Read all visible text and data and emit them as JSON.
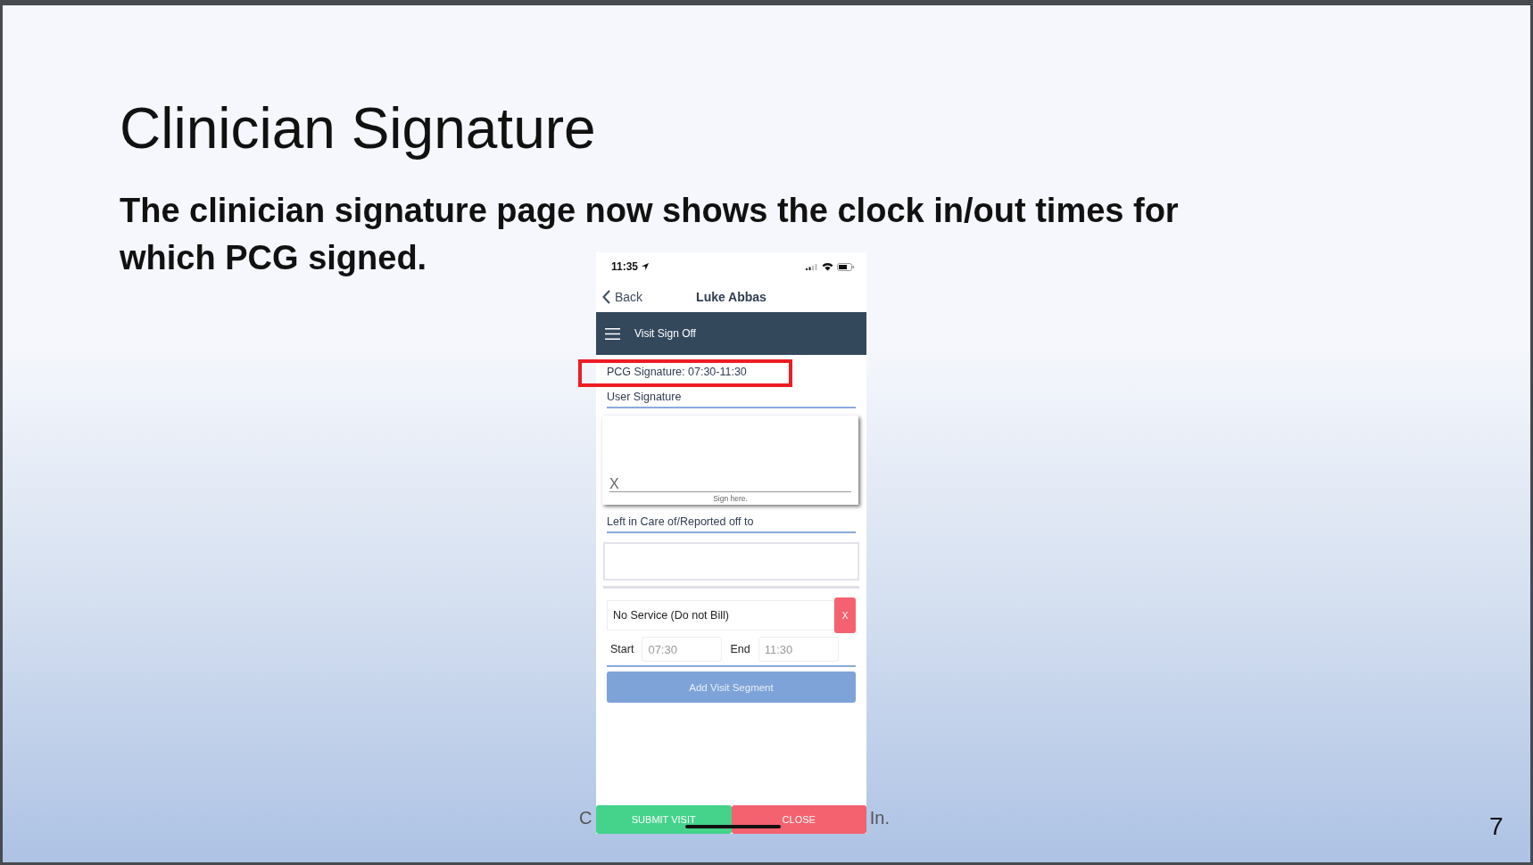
{
  "slide": {
    "title": "Clinician Signature",
    "subtitle_lines": [
      "The clinician signature page now shows the clock in/out times for",
      "which PCG signed."
    ],
    "footer_fragments": [
      "C",
      "In."
    ],
    "page_number": "7"
  },
  "phone": {
    "status_time": "11:35",
    "nav": {
      "back": "Back",
      "title": "Luke Abbas"
    },
    "header": {
      "title": "Visit Sign Off"
    },
    "pcg_signature": {
      "text": "PCG Signature: 07:30-11:30",
      "highlighted": true
    },
    "user_signature": {
      "label": "User Signature",
      "mark": "X",
      "hint": "Sign here."
    },
    "left_in_care": {
      "label": "Left in Care of/Reported off to"
    },
    "segment": {
      "service": "No Service (Do not Bill)",
      "remove": "X",
      "start_label": "Start",
      "start_placeholder": "07:30",
      "end_label": "End",
      "end_placeholder": "11:30"
    },
    "add_button": "Add Visit Segment",
    "actions": [
      {
        "label": "SUBMIT VISIT",
        "kind": "submit"
      },
      {
        "label": "CLOSE",
        "kind": "close"
      }
    ]
  }
}
